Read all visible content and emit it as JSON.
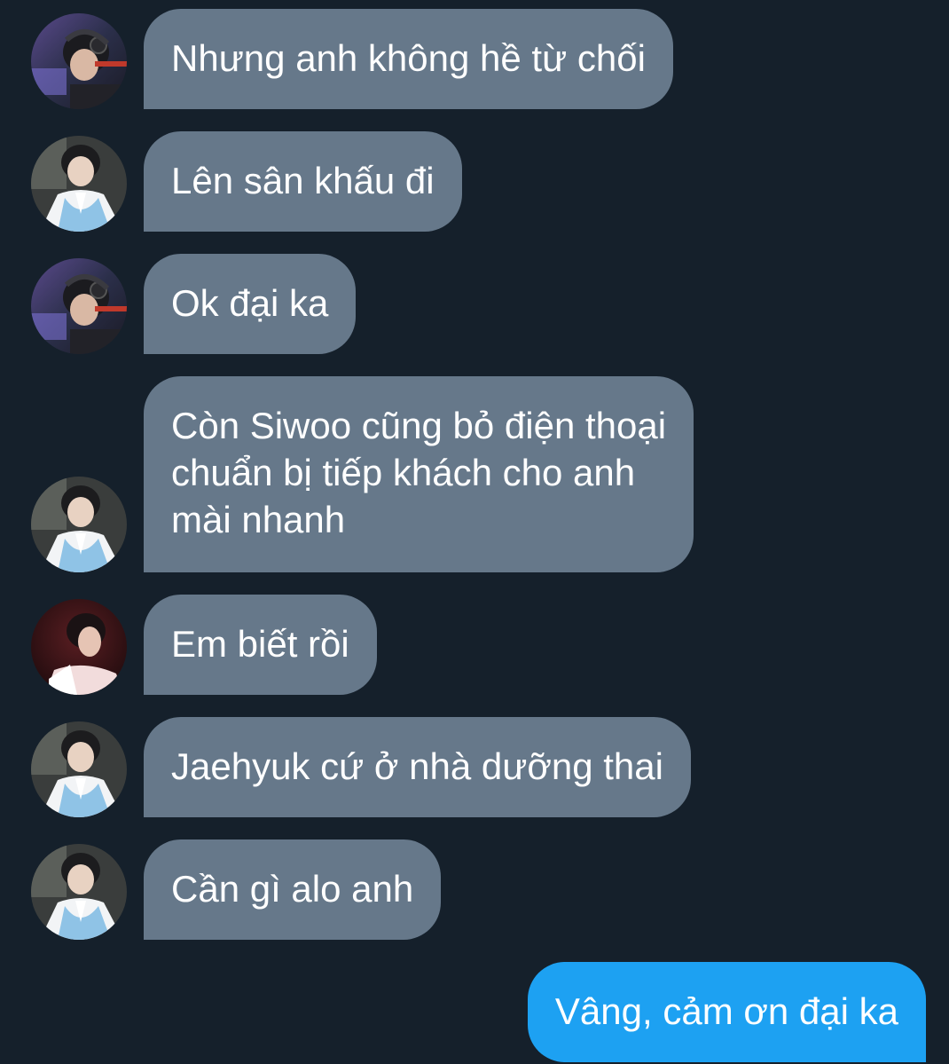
{
  "conversation": {
    "messages": [
      {
        "sender": "headset-user",
        "direction": "incoming",
        "text": "Nhưng anh không hề từ chối"
      },
      {
        "sender": "hanbok-user",
        "direction": "incoming",
        "text": "Lên sân khấu đi"
      },
      {
        "sender": "headset-user",
        "direction": "incoming",
        "text": "Ok đại ka"
      },
      {
        "sender": "hanbok-user",
        "direction": "incoming",
        "text": "Còn Siwoo cũng bỏ điện thoại\nchuẩn bị tiếp khách cho anh\nmài nhanh"
      },
      {
        "sender": "profile-user",
        "direction": "incoming",
        "text": "Em biết rồi"
      },
      {
        "sender": "hanbok-user",
        "direction": "incoming",
        "text": "Jaehyuk cứ ở nhà dưỡng thai"
      },
      {
        "sender": "hanbok-user",
        "direction": "incoming",
        "text": "Cần gì alo anh"
      },
      {
        "sender": "self",
        "direction": "outgoing",
        "text": "Vâng, cảm ơn đại ka"
      }
    ]
  },
  "colors": {
    "background": "#15202b",
    "incoming_bubble": "#66788a",
    "outgoing_bubble": "#1da1f2",
    "text": "#ffffff"
  }
}
